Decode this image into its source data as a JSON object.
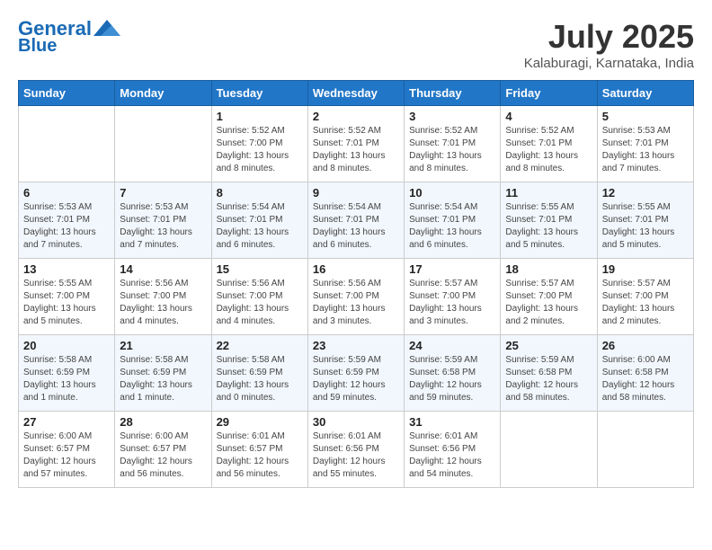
{
  "header": {
    "logo_line1": "General",
    "logo_line2": "Blue",
    "month": "July 2025",
    "location": "Kalaburagi, Karnataka, India"
  },
  "days_of_week": [
    "Sunday",
    "Monday",
    "Tuesday",
    "Wednesday",
    "Thursday",
    "Friday",
    "Saturday"
  ],
  "weeks": [
    [
      {
        "day": "",
        "info": ""
      },
      {
        "day": "",
        "info": ""
      },
      {
        "day": "1",
        "info": "Sunrise: 5:52 AM\nSunset: 7:00 PM\nDaylight: 13 hours\nand 8 minutes."
      },
      {
        "day": "2",
        "info": "Sunrise: 5:52 AM\nSunset: 7:01 PM\nDaylight: 13 hours\nand 8 minutes."
      },
      {
        "day": "3",
        "info": "Sunrise: 5:52 AM\nSunset: 7:01 PM\nDaylight: 13 hours\nand 8 minutes."
      },
      {
        "day": "4",
        "info": "Sunrise: 5:52 AM\nSunset: 7:01 PM\nDaylight: 13 hours\nand 8 minutes."
      },
      {
        "day": "5",
        "info": "Sunrise: 5:53 AM\nSunset: 7:01 PM\nDaylight: 13 hours\nand 7 minutes."
      }
    ],
    [
      {
        "day": "6",
        "info": "Sunrise: 5:53 AM\nSunset: 7:01 PM\nDaylight: 13 hours\nand 7 minutes."
      },
      {
        "day": "7",
        "info": "Sunrise: 5:53 AM\nSunset: 7:01 PM\nDaylight: 13 hours\nand 7 minutes."
      },
      {
        "day": "8",
        "info": "Sunrise: 5:54 AM\nSunset: 7:01 PM\nDaylight: 13 hours\nand 6 minutes."
      },
      {
        "day": "9",
        "info": "Sunrise: 5:54 AM\nSunset: 7:01 PM\nDaylight: 13 hours\nand 6 minutes."
      },
      {
        "day": "10",
        "info": "Sunrise: 5:54 AM\nSunset: 7:01 PM\nDaylight: 13 hours\nand 6 minutes."
      },
      {
        "day": "11",
        "info": "Sunrise: 5:55 AM\nSunset: 7:01 PM\nDaylight: 13 hours\nand 5 minutes."
      },
      {
        "day": "12",
        "info": "Sunrise: 5:55 AM\nSunset: 7:01 PM\nDaylight: 13 hours\nand 5 minutes."
      }
    ],
    [
      {
        "day": "13",
        "info": "Sunrise: 5:55 AM\nSunset: 7:00 PM\nDaylight: 13 hours\nand 5 minutes."
      },
      {
        "day": "14",
        "info": "Sunrise: 5:56 AM\nSunset: 7:00 PM\nDaylight: 13 hours\nand 4 minutes."
      },
      {
        "day": "15",
        "info": "Sunrise: 5:56 AM\nSunset: 7:00 PM\nDaylight: 13 hours\nand 4 minutes."
      },
      {
        "day": "16",
        "info": "Sunrise: 5:56 AM\nSunset: 7:00 PM\nDaylight: 13 hours\nand 3 minutes."
      },
      {
        "day": "17",
        "info": "Sunrise: 5:57 AM\nSunset: 7:00 PM\nDaylight: 13 hours\nand 3 minutes."
      },
      {
        "day": "18",
        "info": "Sunrise: 5:57 AM\nSunset: 7:00 PM\nDaylight: 13 hours\nand 2 minutes."
      },
      {
        "day": "19",
        "info": "Sunrise: 5:57 AM\nSunset: 7:00 PM\nDaylight: 13 hours\nand 2 minutes."
      }
    ],
    [
      {
        "day": "20",
        "info": "Sunrise: 5:58 AM\nSunset: 6:59 PM\nDaylight: 13 hours\nand 1 minute."
      },
      {
        "day": "21",
        "info": "Sunrise: 5:58 AM\nSunset: 6:59 PM\nDaylight: 13 hours\nand 1 minute."
      },
      {
        "day": "22",
        "info": "Sunrise: 5:58 AM\nSunset: 6:59 PM\nDaylight: 13 hours\nand 0 minutes."
      },
      {
        "day": "23",
        "info": "Sunrise: 5:59 AM\nSunset: 6:59 PM\nDaylight: 12 hours\nand 59 minutes."
      },
      {
        "day": "24",
        "info": "Sunrise: 5:59 AM\nSunset: 6:58 PM\nDaylight: 12 hours\nand 59 minutes."
      },
      {
        "day": "25",
        "info": "Sunrise: 5:59 AM\nSunset: 6:58 PM\nDaylight: 12 hours\nand 58 minutes."
      },
      {
        "day": "26",
        "info": "Sunrise: 6:00 AM\nSunset: 6:58 PM\nDaylight: 12 hours\nand 58 minutes."
      }
    ],
    [
      {
        "day": "27",
        "info": "Sunrise: 6:00 AM\nSunset: 6:57 PM\nDaylight: 12 hours\nand 57 minutes."
      },
      {
        "day": "28",
        "info": "Sunrise: 6:00 AM\nSunset: 6:57 PM\nDaylight: 12 hours\nand 56 minutes."
      },
      {
        "day": "29",
        "info": "Sunrise: 6:01 AM\nSunset: 6:57 PM\nDaylight: 12 hours\nand 56 minutes."
      },
      {
        "day": "30",
        "info": "Sunrise: 6:01 AM\nSunset: 6:56 PM\nDaylight: 12 hours\nand 55 minutes."
      },
      {
        "day": "31",
        "info": "Sunrise: 6:01 AM\nSunset: 6:56 PM\nDaylight: 12 hours\nand 54 minutes."
      },
      {
        "day": "",
        "info": ""
      },
      {
        "day": "",
        "info": ""
      }
    ]
  ]
}
